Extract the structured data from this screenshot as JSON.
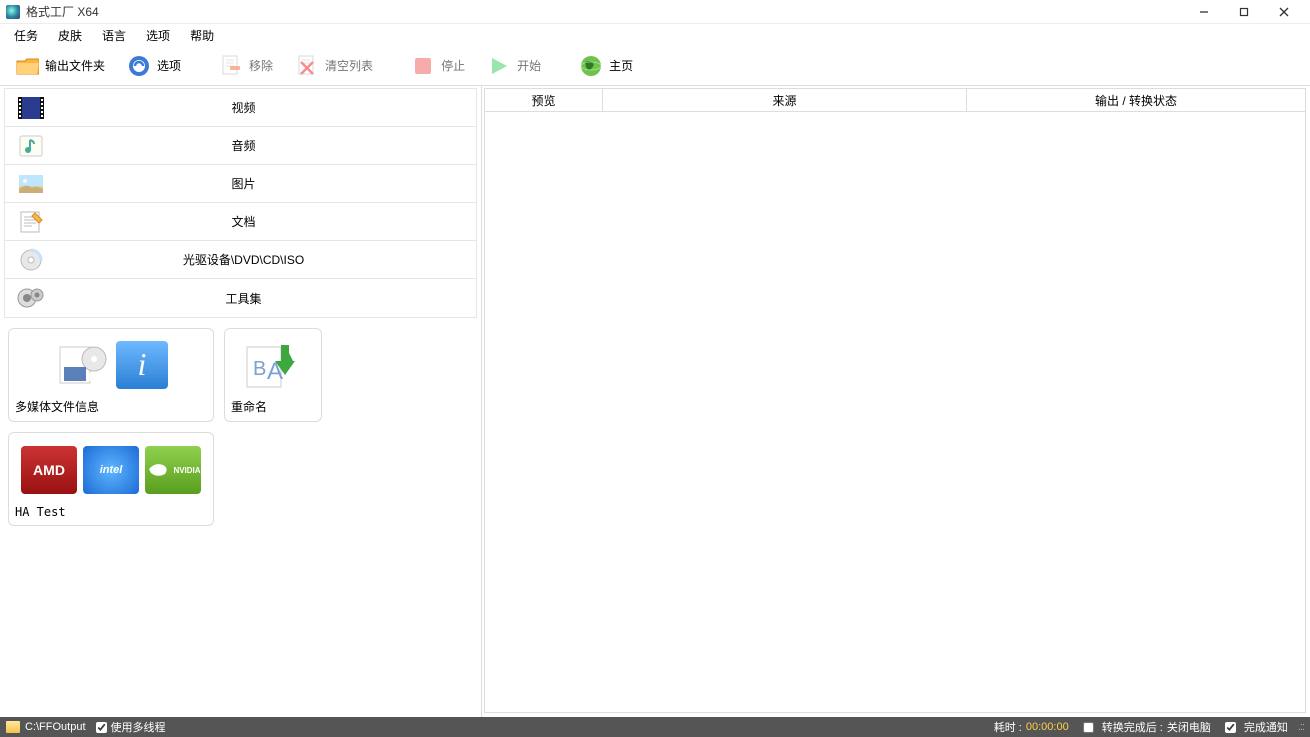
{
  "title": "格式工厂 X64",
  "menu": {
    "task": "任务",
    "skin": "皮肤",
    "lang": "语言",
    "options": "选项",
    "help": "帮助"
  },
  "toolbar": {
    "output_folder": "输出文件夹",
    "options": "选项",
    "remove": "移除",
    "clear": "清空列表",
    "stop": "停止",
    "start": "开始",
    "home": "主页"
  },
  "categories": {
    "video": "视频",
    "audio": "音频",
    "image": "图片",
    "document": "文档",
    "optical": "光驱设备\\DVD\\CD\\ISO",
    "toolset": "工具集"
  },
  "tools": {
    "media_info": "多媒体文件信息",
    "rename": "重命名",
    "ha_test": "HA Test",
    "amd": "AMD",
    "intel": "intel",
    "nvidia": "NVIDIA"
  },
  "table": {
    "preview": "预览",
    "source": "来源",
    "output_status": "输出 / 转换状态"
  },
  "statusbar": {
    "output_path": "C:\\FFOutput",
    "multithread": "使用多线程",
    "elapsed_label": "耗时 :",
    "elapsed_time": "00:00:00",
    "after_label": "转换完成后 :",
    "after_action": "关闭电脑",
    "notify": "完成通知"
  }
}
